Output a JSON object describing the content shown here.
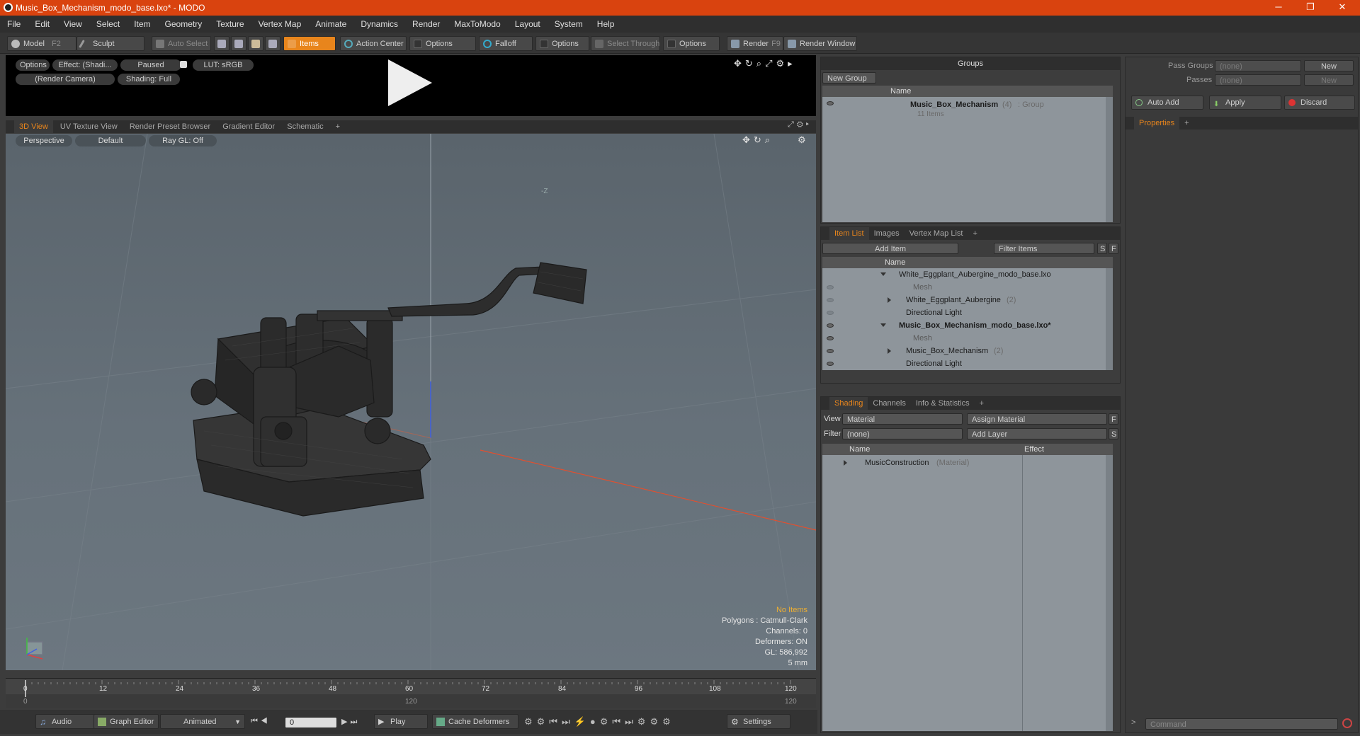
{
  "window": {
    "title": "Music_Box_Mechanism_modo_base.lxo* - MODO",
    "minimize": "─",
    "maximize": "❐",
    "close": "✕"
  },
  "menu": [
    "File",
    "Edit",
    "View",
    "Select",
    "Item",
    "Geometry",
    "Texture",
    "Vertex Map",
    "Animate",
    "Dynamics",
    "Render",
    "MaxToModo",
    "Layout",
    "System",
    "Help"
  ],
  "toolbar": {
    "model": "Model",
    "model_key": "F2",
    "sculpt": "Sculpt",
    "auto_select": "Auto Select",
    "items": "Items",
    "action_center": "Action Center",
    "options1": "Options",
    "falloff": "Falloff",
    "options2": "Options",
    "select_through": "Select Through",
    "options3": "Options",
    "render": "Render",
    "render_key": "F9",
    "render_window": "Render Window"
  },
  "preview": {
    "options": "Options",
    "effect": "Effect: (Shadi...",
    "paused": "Paused",
    "lut": "LUT: sRGB",
    "camera": "(Render Camera)",
    "shading": "Shading: Full"
  },
  "viewport_tabs": [
    "3D View",
    "UV Texture View",
    "Render Preset Browser",
    "Gradient Editor",
    "Schematic",
    "+"
  ],
  "viewport": {
    "perspective": "Perspective",
    "default": "Default",
    "raygl": "Ray GL: Off",
    "axis_label": "-Z",
    "no_items": "No Items",
    "polygons": "Polygons : Catmull-Clark",
    "channels": "Channels: 0",
    "deformers": "Deformers: ON",
    "gl": "GL: 586,992",
    "scale": "5 mm"
  },
  "timeline": {
    "ticks": [
      "0",
      "12",
      "24",
      "36",
      "48",
      "60",
      "72",
      "84",
      "96",
      "108",
      "120"
    ],
    "start": "0",
    "end_mid": "120",
    "end": "120"
  },
  "bottom": {
    "audio": "Audio",
    "graph_editor": "Graph Editor",
    "animated": "Animated",
    "frame": "0",
    "play": "Play",
    "cache": "Cache Deformers",
    "settings": "Settings"
  },
  "groups": {
    "title": "Groups",
    "new_group": "New Group",
    "col_name": "Name",
    "group_name": "Music_Box_Mechanism",
    "group_count": "(4)",
    "group_type": ": Group",
    "group_items": "11 Items"
  },
  "item_list": {
    "tabs": [
      "Item List",
      "Images",
      "Vertex Map List",
      "+"
    ],
    "add_item": "Add Item",
    "filter": "Filter Items",
    "s": "S",
    "f": "F",
    "col_name": "Name",
    "rows": [
      {
        "label": "White_Eggplant_Aubergine_modo_base.lxo",
        "extra": ""
      },
      {
        "label": "Mesh",
        "extra": ""
      },
      {
        "label": "White_Eggplant_Aubergine",
        "extra": "(2)"
      },
      {
        "label": "Directional Light",
        "extra": ""
      },
      {
        "label": "Music_Box_Mechanism_modo_base.lxo*",
        "extra": ""
      },
      {
        "label": "Mesh",
        "extra": ""
      },
      {
        "label": "Music_Box_Mechanism",
        "extra": "(2)"
      },
      {
        "label": "Directional Light",
        "extra": ""
      }
    ]
  },
  "shading": {
    "tabs": [
      "Shading",
      "Channels",
      "Info & Statistics",
      "+"
    ],
    "view_label": "View",
    "view_value": "Material",
    "assign": "Assign Material",
    "filter_label": "Filter",
    "filter_value": "(none)",
    "add_layer": "Add Layer",
    "f": "F",
    "s": "S",
    "col_name": "Name",
    "col_effect": "Effect",
    "material": "MusicConstruction",
    "material_type": "(Material)"
  },
  "right": {
    "pass_groups": "Pass Groups",
    "passes": "Passes",
    "none1": "(none)",
    "none2": "(none)",
    "new1": "New",
    "new2": "New",
    "auto_add": "Auto Add",
    "apply": "Apply",
    "discard": "Discard",
    "properties": "Properties",
    "plus": "+",
    "command": "Command"
  },
  "colors": {
    "accent": "#e8851c",
    "titlebar": "#d9430f"
  }
}
